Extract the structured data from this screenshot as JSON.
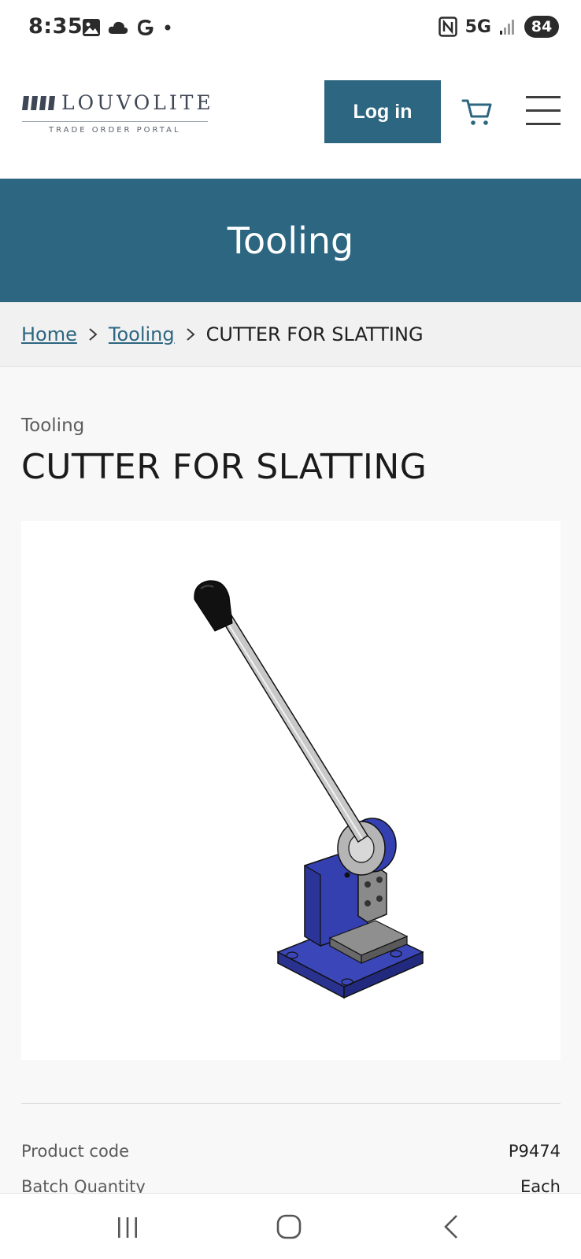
{
  "status_bar": {
    "time": "8:35",
    "network": "5G",
    "battery": "84",
    "left_icons": [
      "gallery-icon",
      "cloud-icon",
      "google-icon",
      "dot-icon"
    ],
    "right_icons": [
      "nfc-icon",
      "signal-icon"
    ]
  },
  "header": {
    "logo_word": "LOUVOLITE",
    "logo_subtitle": "TRADE ORDER PORTAL",
    "login_label": "Log in",
    "accent": "#2c6680"
  },
  "banner": {
    "title": "Tooling"
  },
  "breadcrumb": {
    "home": "Home",
    "category": "Tooling",
    "current": "CUTTER FOR SLATTING"
  },
  "product": {
    "category": "Tooling",
    "title": "CUTTER FOR SLATTING",
    "details": [
      {
        "label": "Product code",
        "value": "P9474"
      },
      {
        "label": "Batch Quantity",
        "value": "Each"
      }
    ]
  },
  "navbar": {
    "icons": [
      "recent-apps-icon",
      "home-icon",
      "back-icon"
    ]
  }
}
